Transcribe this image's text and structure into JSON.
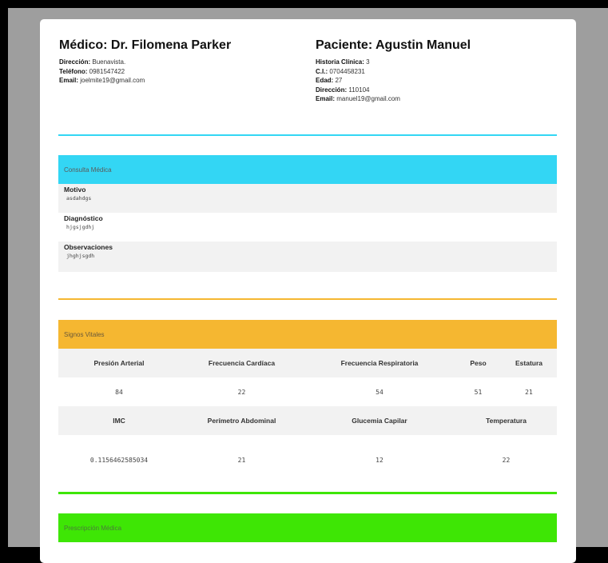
{
  "medico": {
    "heading": "Médico: Dr. Filomena Parker",
    "lines": [
      {
        "label": "Dirección:",
        "value": "Buenavista."
      },
      {
        "label": "Teléfono:",
        "value": "0981547422"
      },
      {
        "label": "Email:",
        "value": "joelmite19@gmail.com"
      }
    ]
  },
  "paciente": {
    "heading": "Paciente: Agustin Manuel",
    "lines": [
      {
        "label": "Historia Clínica:",
        "value": "3"
      },
      {
        "label": "C.I.:",
        "value": "0704458231"
      },
      {
        "label": "Edad:",
        "value": "27"
      },
      {
        "label": "Dirección:",
        "value": "110104"
      },
      {
        "label": "Email:",
        "value": "manuel19@gmail.com"
      }
    ]
  },
  "consulta": {
    "title": "Consulta Médica",
    "color": "#33d6f4",
    "fields": [
      {
        "label": "Motivo",
        "value": "asdahdgs"
      },
      {
        "label": "Diagnóstico",
        "value": "hjgsjgdhj"
      },
      {
        "label": "Observaciones",
        "value": "jhghjsgdh"
      }
    ]
  },
  "signos": {
    "title": "Signos Vitales",
    "color": "#f5b731",
    "row1_headers": [
      "Presión Arterial",
      "Frecuencia Cardíaca",
      "Frecuencia Respiratoria",
      "Peso",
      "Estatura"
    ],
    "row1_values": [
      "84",
      "22",
      "54",
      "51",
      "21"
    ],
    "row2_headers": [
      "IMC",
      "Perímetro Abdominal",
      "Glucemia Capilar",
      "Temperatura"
    ],
    "row2_values": [
      "0.1156462585034",
      "21",
      "12",
      "22"
    ]
  },
  "prescripcion": {
    "title": "Prescripción Médica",
    "color": "#3ee605"
  }
}
